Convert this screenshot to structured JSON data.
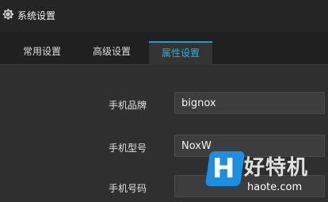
{
  "window": {
    "title": "系统设置",
    "icon": "gear-icon"
  },
  "tabs": [
    {
      "label": "常用设置",
      "active": false
    },
    {
      "label": "高级设置",
      "active": false
    },
    {
      "label": "属性设置",
      "active": true
    }
  ],
  "form": {
    "brand_label": "手机品牌",
    "brand_value": "bignox",
    "model_label": "手机型号",
    "model_value": "NoxW",
    "number_label": "手机号码",
    "number_value": ""
  },
  "watermark": {
    "badge": "H",
    "text": "好特机",
    "url": "haote.com"
  },
  "colors": {
    "accent": "#1fb0e2",
    "background": "#2d2d2d",
    "input_bg": "#3d3d3d"
  }
}
